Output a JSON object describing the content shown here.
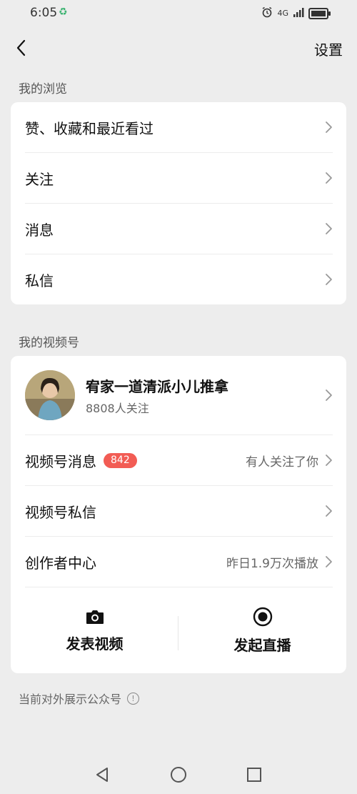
{
  "status": {
    "time": "6:05",
    "network": "4G"
  },
  "nav": {
    "settings_label": "设置"
  },
  "browse": {
    "title": "我的浏览",
    "items": [
      {
        "label": "赞、收藏和最近看过"
      },
      {
        "label": "关注"
      },
      {
        "label": "消息"
      },
      {
        "label": "私信"
      }
    ]
  },
  "channels": {
    "title": "我的视频号",
    "profile": {
      "name": "宥家一道清派小儿推拿",
      "followers": "8808人关注"
    },
    "items": [
      {
        "label": "视频号消息",
        "badge": "842",
        "right": "有人关注了你"
      },
      {
        "label": "视频号私信",
        "right": ""
      },
      {
        "label": "创作者中心",
        "right": "昨日1.9万次播放"
      }
    ],
    "actions": [
      {
        "label": "发表视频",
        "icon": "camera-icon"
      },
      {
        "label": "发起直播",
        "icon": "live-icon"
      }
    ]
  },
  "footer_note": "当前对外展示公众号",
  "colors": {
    "badge": "#f25c54",
    "background": "#ededed",
    "card": "#ffffff"
  }
}
